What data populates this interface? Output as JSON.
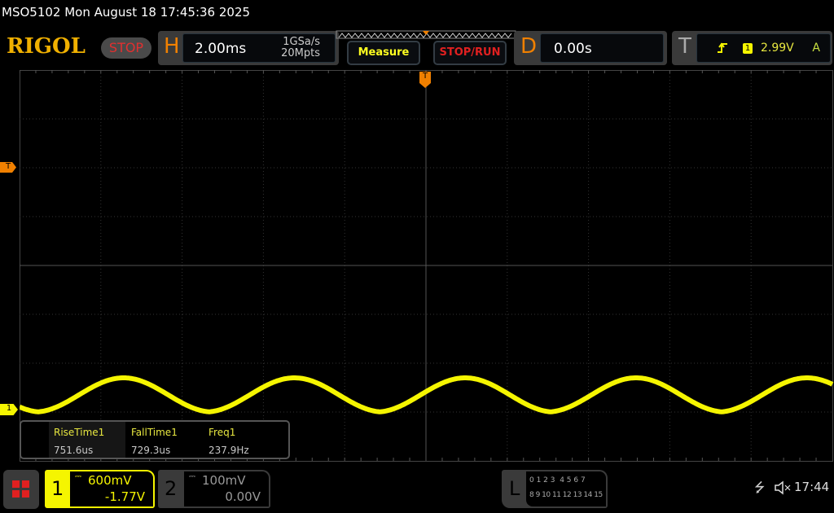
{
  "title": "MSO5102  Mon August 18 17:45:36 2025",
  "logo": "RIGOL",
  "run_state": "STOP",
  "horizontal": {
    "letter": "H",
    "timebase": "2.00ms",
    "sample_rate": "1GSa/s",
    "memory_depth": "20Mpts"
  },
  "buttons": {
    "measure": "Measure",
    "stop_run": "STOP/RUN"
  },
  "delay": {
    "letter": "D",
    "value": "0.00s"
  },
  "trigger": {
    "letter": "T",
    "source": "1",
    "level": "2.99V",
    "mode": "A",
    "marker": "T"
  },
  "measurements": [
    {
      "label": "RiseTime1",
      "value": "751.6us"
    },
    {
      "label": "FallTime1",
      "value": "729.3us"
    },
    {
      "label": "Freq1",
      "value": "237.9Hz"
    }
  ],
  "channels": [
    {
      "number": "1",
      "scale": "600mV",
      "offset": "-1.77V",
      "active": true
    },
    {
      "number": "2",
      "scale": "100mV",
      "offset": "0.00V",
      "active": false
    }
  ],
  "logic": {
    "letter": "L",
    "row1": "0 1 2 3  4 5 6 7",
    "row2": "8 9 10 11 12 13 14 15"
  },
  "clock": "17:44",
  "waveform": {
    "color": "#f5f500",
    "frequency_hz": 237.9,
    "time_per_div_ms": 2,
    "baseline_div": -3,
    "peak_div": -2.3
  },
  "colors": {
    "accent": "#f08000",
    "channel1": "#f5f500",
    "stop": "#e03030"
  }
}
